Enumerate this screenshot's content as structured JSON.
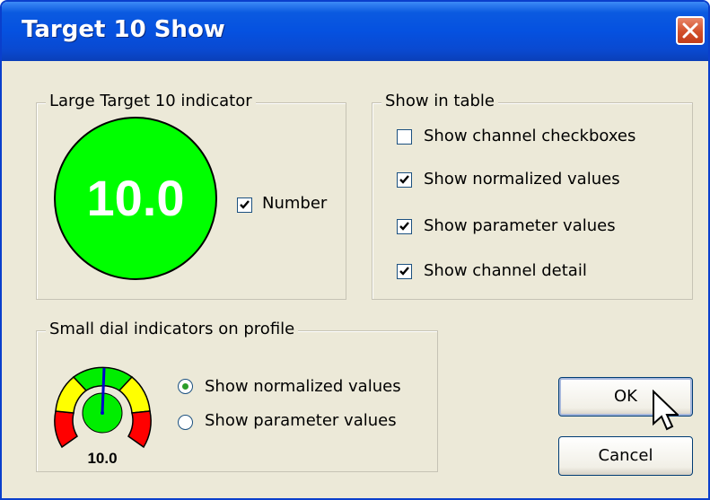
{
  "window": {
    "title": "Target 10 Show"
  },
  "large_indicator": {
    "group_label": "Large Target 10 indicator",
    "value_text": "10.0",
    "number_checkbox": {
      "label": "Number",
      "checked": true
    }
  },
  "show_in_table": {
    "group_label": "Show in table",
    "options": [
      {
        "label": "Show channel checkboxes",
        "checked": false
      },
      {
        "label": "Show normalized values",
        "checked": true
      },
      {
        "label": "Show parameter values",
        "checked": true
      },
      {
        "label": "Show channel detail",
        "checked": true
      }
    ]
  },
  "small_dial": {
    "group_label": "Small dial indicators on profile",
    "value_text": "10.0",
    "options": [
      {
        "label": "Show normalized values",
        "selected": true
      },
      {
        "label": "Show parameter values",
        "selected": false
      }
    ]
  },
  "buttons": {
    "ok": "OK",
    "cancel": "Cancel"
  },
  "colors": {
    "titlebar": "#0551e0",
    "indicator_green": "#00ff00",
    "dialog_bg": "#ece9d8"
  }
}
